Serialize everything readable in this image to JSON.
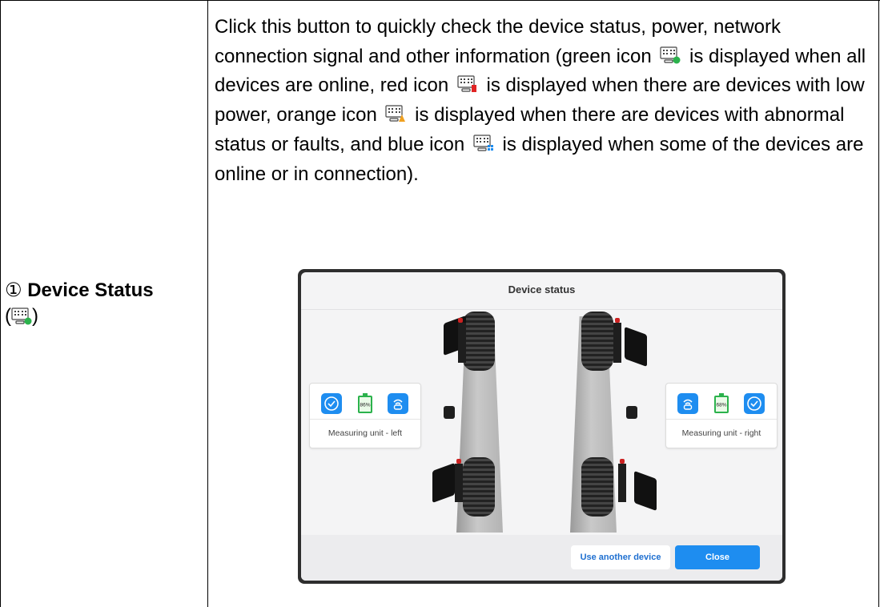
{
  "label": {
    "number": "①",
    "title": "Device Status",
    "paren_open": "(",
    "paren_close": ")",
    "icon": "device-monitor-green-icon"
  },
  "description": {
    "part1": "Click this button to quickly check the device status, power, network connection signal and other information (green icon",
    "part2": "is displayed when all devices are online, red icon",
    "part3": "is displayed when there are devices with low power, orange icon",
    "part4": "is displayed when there are devices with abnormal status or faults, and blue icon",
    "part5": "is displayed when some of the devices are online or in connection).",
    "icons": [
      "device-monitor-green-icon",
      "device-monitor-red-icon",
      "device-monitor-orange-icon",
      "device-monitor-blue-icon"
    ]
  },
  "dialog": {
    "title": "Device status",
    "left_unit": {
      "label": "Measuring unit - left",
      "battery": "86%",
      "icons": [
        "check-icon",
        "battery-icon",
        "signal-icon"
      ]
    },
    "right_unit": {
      "label": "Measuring unit - right",
      "battery": "68%",
      "icons": [
        "signal-icon",
        "battery-icon",
        "check-icon"
      ]
    },
    "buttons": {
      "another": "Use another device",
      "close": "Close"
    }
  },
  "colors": {
    "accent_blue": "#1e8df0",
    "battery_green": "#2bb24c",
    "status_green": "#2bb24c",
    "status_red": "#e02424",
    "status_orange": "#f0a020",
    "status_blue": "#1e8df0"
  }
}
